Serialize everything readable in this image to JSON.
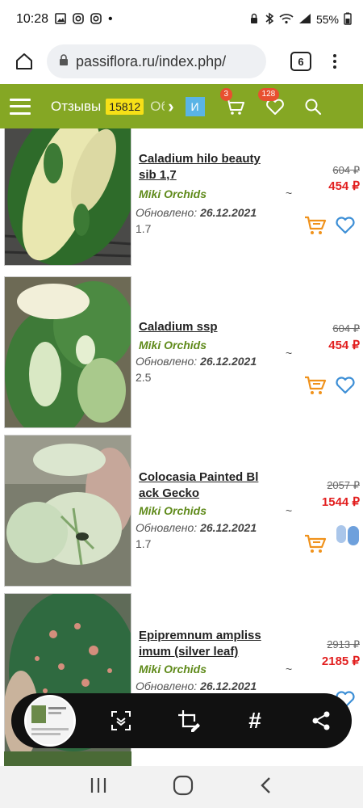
{
  "status_bar": {
    "time": "10:28",
    "notif_dot": "•",
    "battery": "55%"
  },
  "browser": {
    "url": "passiflora.ru/index.php/",
    "tab_count": "6"
  },
  "site_nav": {
    "reviews_label": "Отзывы",
    "reviews_count": "15812",
    "more_label": "Об",
    "lang_label": "И",
    "cart_badge": "3",
    "favorites_badge": "128"
  },
  "products": [
    {
      "title": "Caladium hilo beauty sib 1,7",
      "seller": "Miki Orchids",
      "updated_label": "Обновлено:",
      "updated_date": "26.12.2021",
      "size": "1.7",
      "tilde": "~",
      "old_price": "604 ₽",
      "price": "454 ₽"
    },
    {
      "title": "Caladium ssp",
      "seller": "Miki Orchids",
      "updated_label": "Обновлено:",
      "updated_date": "26.12.2021",
      "size": "2.5",
      "tilde": "~",
      "old_price": "604 ₽",
      "price": "454 ₽"
    },
    {
      "title": "Colocasia Painted Bl ack Gecko",
      "seller": "Miki Orchids",
      "updated_label": "Обновлено:",
      "updated_date": "26.12.2021",
      "size": "1.7",
      "tilde": "~",
      "old_price": "2057 ₽",
      "price": "1544 ₽"
    },
    {
      "title": "Epipremnum ampliss imum (silver leaf)",
      "seller": "Miki Orchids",
      "updated_label": "Обновлено:",
      "updated_date": "26.12.2021",
      "size": "",
      "tilde": "~",
      "old_price": "2913 ₽",
      "price": "2185 ₽"
    }
  ],
  "screenshot_toolbar": {
    "tag_label": "#"
  },
  "colors": {
    "nav_green": "#85a724",
    "seller_green": "#5f8a1a",
    "price_red": "#e21f1f",
    "cart_orange": "#f0921c",
    "fav_blue": "#3d8fd6"
  }
}
